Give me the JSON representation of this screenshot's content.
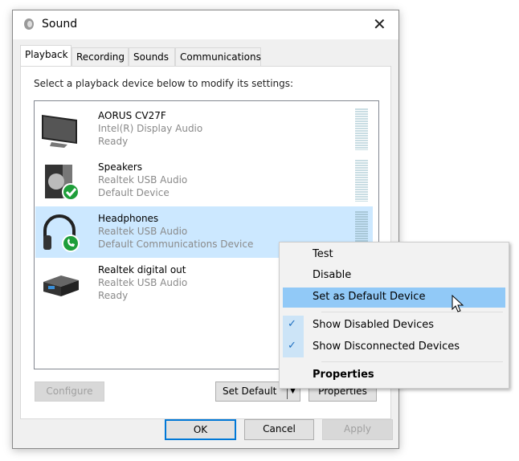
{
  "window": {
    "title": "Sound",
    "icon": "speaker-icon",
    "close_icon": "close-icon"
  },
  "tabs": [
    "Playback",
    "Recording",
    "Sounds",
    "Communications"
  ],
  "instruction": "Select a playback device below to modify its settings:",
  "devices": [
    {
      "name": "AORUS CV27F",
      "driver": "Intel(R) Display Audio",
      "status": "Ready",
      "icon": "monitor-icon"
    },
    {
      "name": "Speakers",
      "driver": "Realtek USB Audio",
      "status": "Default Device",
      "icon": "speaker-device-icon",
      "badge": "checkmark-badge-icon"
    },
    {
      "name": "Headphones",
      "driver": "Realtek USB Audio",
      "status": "Default Communications Device",
      "icon": "headphones-icon",
      "badge": "phone-badge-icon",
      "selected": true
    },
    {
      "name": "Realtek digital out",
      "driver": "Realtek USB Audio",
      "status": "Ready",
      "icon": "digital-out-icon"
    }
  ],
  "buttons": {
    "configure": "Configure",
    "set_default": "Set Default",
    "properties": "Properties",
    "ok": "OK",
    "cancel": "Cancel",
    "apply": "Apply"
  },
  "context_menu": {
    "items": [
      {
        "label": "Test"
      },
      {
        "label": "Disable"
      },
      {
        "label": "Set as Default Device",
        "highlighted": true
      },
      {
        "label": "Show Disabled Devices",
        "checked": true
      },
      {
        "label": "Show Disconnected Devices",
        "checked": true
      },
      {
        "label": "Properties",
        "bold": true
      }
    ]
  },
  "colors": {
    "selection": "#cce8ff",
    "menu_highlight": "#91c9f7",
    "accent": "#0078d7",
    "badge_green": "#1e9e3a"
  }
}
